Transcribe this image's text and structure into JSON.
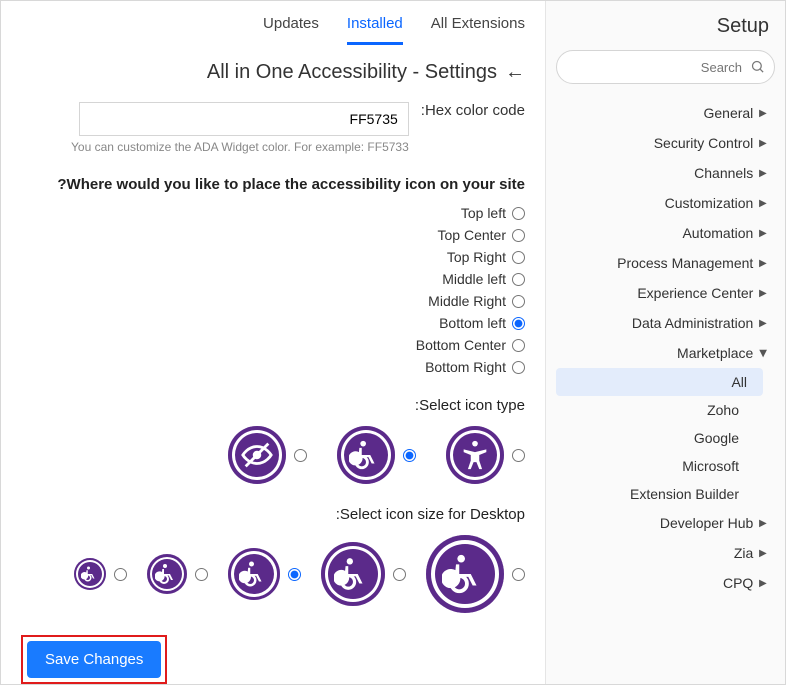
{
  "sidebar": {
    "title": "Setup",
    "search_placeholder": "Search",
    "items": [
      {
        "label": "General",
        "expanded": false
      },
      {
        "label": "Security Control",
        "expanded": false
      },
      {
        "label": "Channels",
        "expanded": false
      },
      {
        "label": "Customization",
        "expanded": false
      },
      {
        "label": "Automation",
        "expanded": false
      },
      {
        "label": "Process Management",
        "expanded": false
      },
      {
        "label": "Experience Center",
        "expanded": false
      },
      {
        "label": "Data Administration",
        "expanded": false
      },
      {
        "label": "Marketplace",
        "expanded": true,
        "children": [
          {
            "label": "All",
            "active": true
          },
          {
            "label": "Zoho"
          },
          {
            "label": "Google"
          },
          {
            "label": "Microsoft"
          },
          {
            "label": "Extension Builder"
          }
        ]
      },
      {
        "label": "Developer Hub",
        "expanded": false
      },
      {
        "label": "Zia",
        "expanded": false
      },
      {
        "label": "CPQ",
        "expanded": false
      }
    ]
  },
  "tabs": [
    {
      "label": "All Extensions",
      "active": false
    },
    {
      "label": "Installed",
      "active": true
    },
    {
      "label": "Updates",
      "active": false
    }
  ],
  "page": {
    "title": "All in One Accessibility - Settings",
    "hex_label": "Hex color code:",
    "hex_value": "FF5735",
    "hex_help": "You can customize the ADA Widget color. For example: FF5733",
    "placement_q": "Where would you like to place the accessibility icon on your site?",
    "placements": [
      "Top left",
      "Top Center",
      "Top Right",
      "Middle left",
      "Middle Right",
      "Bottom left",
      "Bottom Center",
      "Bottom Right"
    ],
    "placement_selected": "Bottom left",
    "icon_type_label": "Select icon type:",
    "icon_types": [
      "type-a",
      "type-b",
      "type-c"
    ],
    "icon_type_selected": "type-b",
    "icon_size_label": "Select icon size for Desktop:",
    "icon_size_selected": 3,
    "save_label": "Save Changes"
  }
}
